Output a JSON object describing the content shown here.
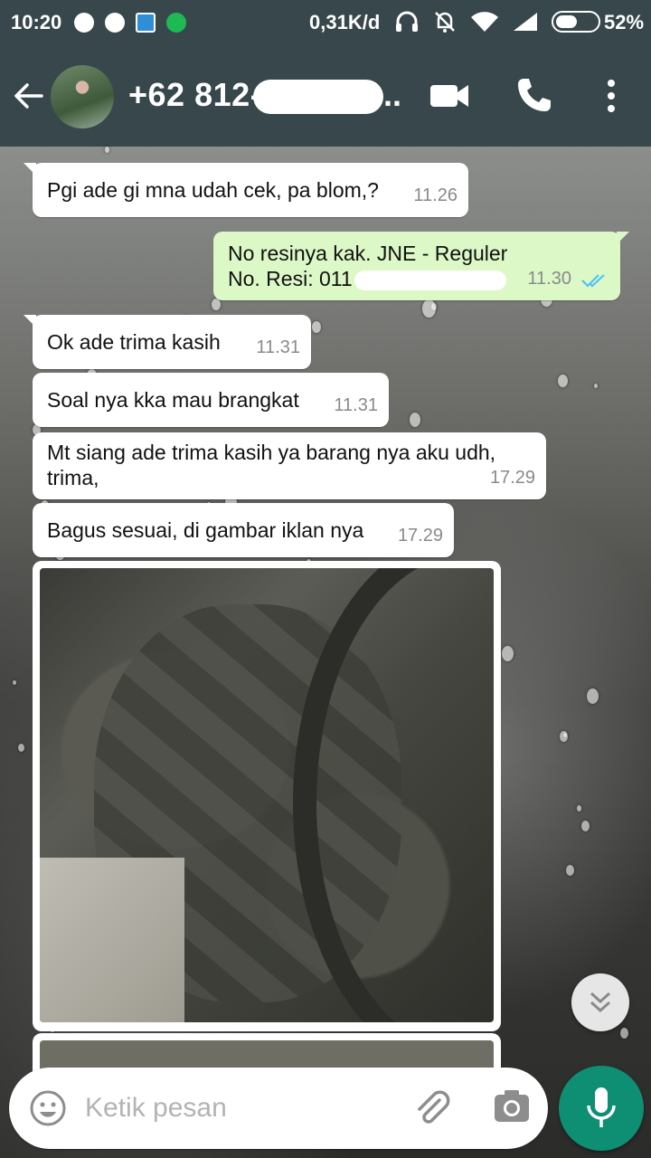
{
  "status_bar": {
    "time": "10:20",
    "network_speed": "0,31K/d",
    "battery_percent": "52%",
    "battery_level": 0.52,
    "left_icons": [
      "whatsapp-icon",
      "messenger-icon",
      "upload-icon",
      "spotify-icon"
    ],
    "right_icons": [
      "headset-icon",
      "muted-bell-icon",
      "wifi-icon",
      "signal-icon",
      "battery-icon"
    ]
  },
  "header": {
    "contact_name": "+62 812-",
    "name_suffix": "..",
    "icons": [
      "back-arrow-icon",
      "video-call-icon",
      "phone-call-icon",
      "more-options-icon"
    ]
  },
  "messages": [
    {
      "direction": "incoming",
      "text": "Pgi ade gi mna udah cek, pa blom,?",
      "time": "11.26"
    },
    {
      "direction": "outgoing",
      "line1": "No resinya kak. JNE - Reguler",
      "line2_prefix": "No. Resi: 011",
      "time": "11.30",
      "status": "read"
    },
    {
      "direction": "incoming",
      "text": "Ok ade trima kasih",
      "time": "11.31"
    },
    {
      "direction": "incoming",
      "text": "Soal nya kka mau brangkat",
      "time": "11.31"
    },
    {
      "direction": "incoming",
      "line1": "Mt siang ade trima kasih ya barang nya aku udh,",
      "line2": "trima,",
      "time": "17.29"
    },
    {
      "direction": "incoming",
      "text": "Bagus sesuai, di gambar iklan nya",
      "time": "17.29"
    }
  ],
  "input": {
    "placeholder": "Ketik pesan",
    "value": ""
  },
  "colors": {
    "header_bg": "#37474b",
    "outgoing_bubble": "#dcf8c6",
    "incoming_bubble": "#ffffff",
    "read_ticks": "#4fc3f7",
    "mic_button": "#0e8f74"
  }
}
